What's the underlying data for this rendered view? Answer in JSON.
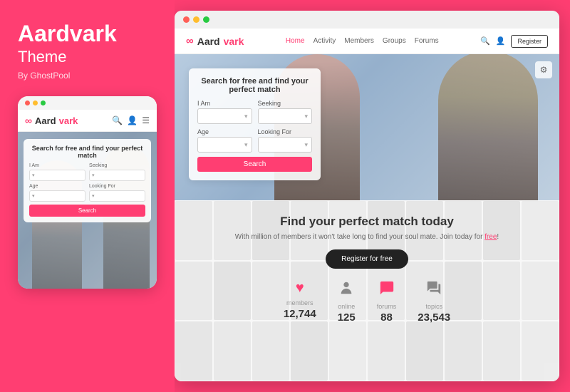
{
  "left": {
    "brand_title": "Aardvark",
    "brand_subtitle": "Theme",
    "brand_by": "By GhostPool"
  },
  "mobile": {
    "logo_text_dark": "Aard",
    "logo_text_pink": "vark",
    "search_title": "Search for free and find your perfect match",
    "form": {
      "i_am_label": "I Am",
      "seeking_label": "Seeking",
      "age_label": "Age",
      "looking_for_label": "Looking For",
      "search_btn": "Search"
    }
  },
  "desktop": {
    "nav": {
      "logo_dark": "Aard",
      "logo_pink": "vark",
      "links": [
        "Home",
        "Activity",
        "Members",
        "Groups",
        "Forums"
      ],
      "active_link": "Home",
      "register_btn": "Register"
    },
    "hero": {
      "search_title": "Search for free and find your perfect match",
      "form": {
        "i_am_label": "I Am",
        "seeking_label": "Seeking",
        "age_label": "Age",
        "looking_for_label": "Looking For",
        "search_btn": "Search"
      }
    },
    "content": {
      "heading": "Find your perfect match today",
      "subtext_before": "With million of members it won't take long to find your soul mate. Join today for ",
      "subtext_link": "free",
      "subtext_after": "!",
      "register_btn": "Register for free"
    },
    "stats": [
      {
        "icon": "heart",
        "label": "members",
        "value": "12,744"
      },
      {
        "icon": "person",
        "label": "online",
        "value": "125"
      },
      {
        "icon": "bubble",
        "label": "forums",
        "value": "88"
      },
      {
        "icon": "bubbles",
        "label": "topics",
        "value": "23,543"
      }
    ]
  },
  "colors": {
    "brand_pink": "#FF3E72",
    "dark": "#222",
    "light_bg": "#f8f8f8"
  }
}
